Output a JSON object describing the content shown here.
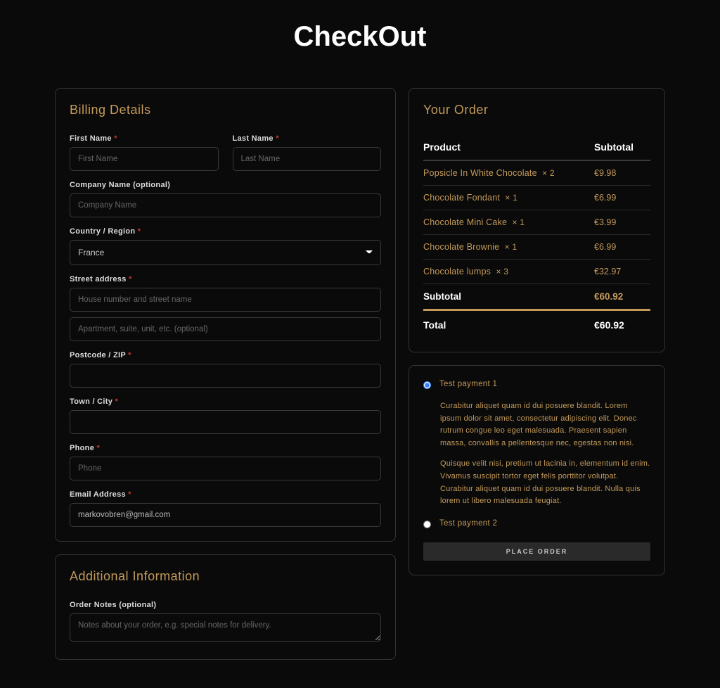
{
  "page_title": "CheckOut",
  "billing": {
    "section_title": "Billing Details",
    "first_name": {
      "label": "First Name",
      "placeholder": "First Name",
      "required": true
    },
    "last_name": {
      "label": "Last Name",
      "placeholder": "Last Name",
      "required": true
    },
    "company": {
      "label": "Company Name (optional)",
      "placeholder": "Company Name",
      "required": false
    },
    "country": {
      "label": "Country / Region",
      "value": "France",
      "required": true
    },
    "street": {
      "label": "Street address",
      "placeholder1": "House number and street name",
      "placeholder2": "Apartment, suite, unit, etc. (optional)",
      "required": true
    },
    "postcode": {
      "label": "Postcode / ZIP",
      "required": true
    },
    "city": {
      "label": "Town / City",
      "required": true
    },
    "phone": {
      "label": "Phone",
      "placeholder": "Phone",
      "required": true
    },
    "email": {
      "label": "Email Address",
      "value": "markovobren@gmail.com",
      "required": true
    }
  },
  "additional": {
    "section_title": "Additional Information",
    "notes": {
      "label": "Order Notes (optional)",
      "placeholder": "Notes about your order, e.g. special notes for delivery."
    }
  },
  "order": {
    "section_title": "Your Order",
    "header_product": "Product",
    "header_subtotal": "Subtotal",
    "items": [
      {
        "name": "Popsicle In White Chocolate",
        "qty": "× 2",
        "price": "€9.98"
      },
      {
        "name": "Chocolate Fondant",
        "qty": "× 1",
        "price": "€6.99"
      },
      {
        "name": "Chocolate Mini Cake",
        "qty": "× 1",
        "price": "€3.99"
      },
      {
        "name": "Chocolate Brownie",
        "qty": "× 1",
        "price": "€6.99"
      },
      {
        "name": "Chocolate lumps",
        "qty": "× 3",
        "price": "€32.97"
      }
    ],
    "subtotal_label": "Subtotal",
    "subtotal_value": "€60.92",
    "total_label": "Total",
    "total_value": "€60.92"
  },
  "payment": {
    "options": [
      {
        "label": "Test payment 1",
        "selected": true,
        "desc1": "Curabitur aliquet quam id dui posuere blandit. Lorem ipsum dolor sit amet, consectetur adipiscing elit. Donec rutrum congue leo eget malesuada. Praesent sapien massa, convallis a pellentesque nec, egestas non nisi.",
        "desc2": "Quisque velit nisi, pretium ut lacinia in, elementum id enim. Vivamus suscipit tortor eget felis porttitor volutpat. Curabitur aliquet quam id dui posuere blandit. Nulla quis lorem ut libero malesuada feugiat."
      },
      {
        "label": "Test payment 2",
        "selected": false
      }
    ],
    "button_label": "PLACE ORDER"
  }
}
